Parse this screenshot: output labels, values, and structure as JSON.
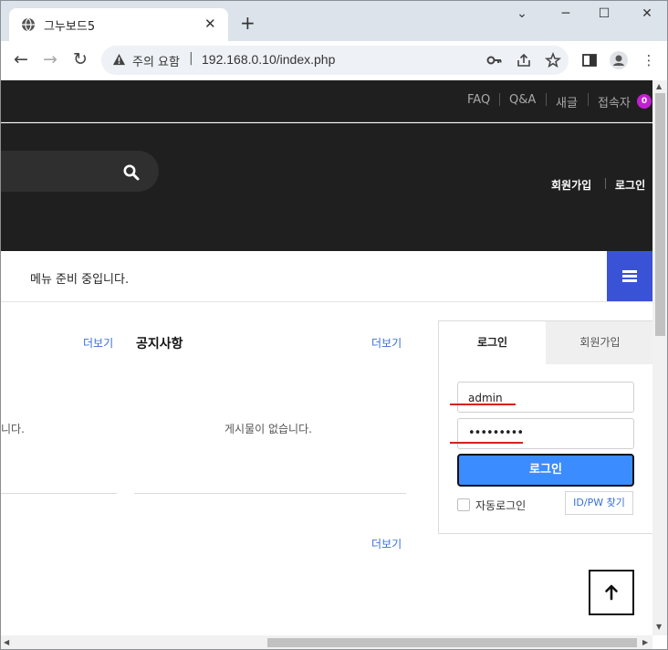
{
  "browser": {
    "tab_title": "그누보드5",
    "tab_close": "✕",
    "new_tab": "+",
    "window_minimize": "─",
    "window_maximize": "☐",
    "window_close": "✕",
    "window_chevron": "⌄",
    "security_label": "주의 요함",
    "separator": "|",
    "url": "192.168.0.10/index.php"
  },
  "site": {
    "top_links": [
      "FAQ",
      "Q&A",
      "새글",
      "접속자"
    ],
    "visitor_count": "0",
    "header_links": {
      "register": "회원가입",
      "login": "로그인"
    },
    "menu_placeholder": "메뉴 준비 중입니다."
  },
  "sections": {
    "left": {
      "more": "더보기",
      "empty_partial": "니다."
    },
    "notice": {
      "title": "공지사항",
      "more": "더보기",
      "empty": "게시물이 없습니다."
    },
    "bottom": {
      "more": "더보기"
    }
  },
  "login_box": {
    "tab_login": "로그인",
    "tab_register": "회원가입",
    "username_value": "admin",
    "password_value": "•••••••••",
    "login_button": "로그인",
    "auto_login": "자동로그인",
    "find_idpw": "ID/PW 찾기"
  },
  "colors": {
    "header_bg": "#1f1f1f",
    "hamburger_bg": "#3a53d6",
    "login_btn_bg": "#3b8cff",
    "badge": "#c21fd3",
    "link": "#3a6fd6",
    "annotation_red": "#d62020"
  }
}
